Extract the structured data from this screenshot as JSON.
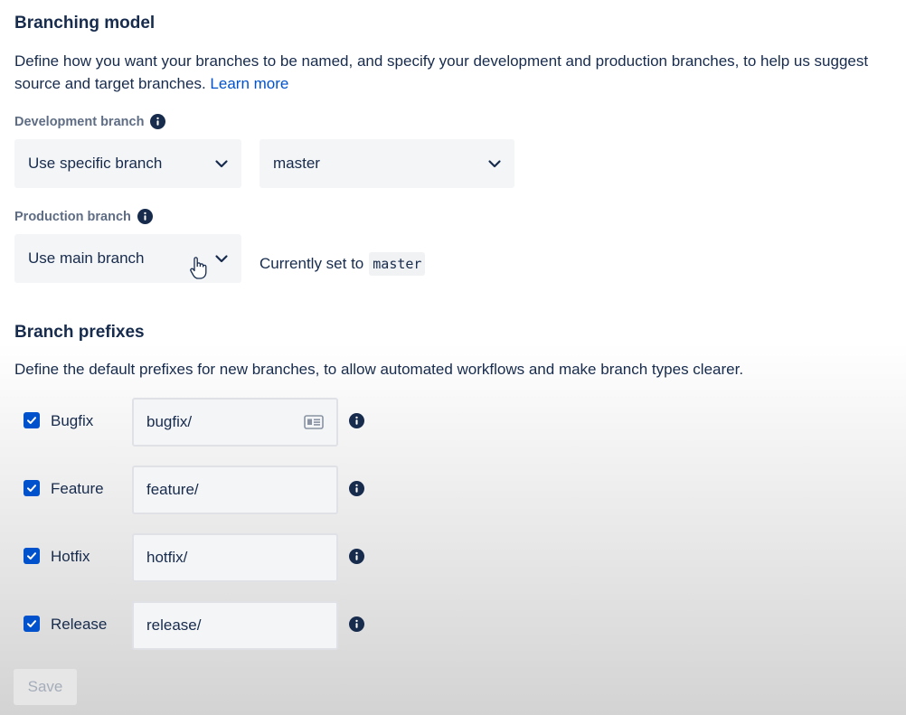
{
  "branching_model": {
    "heading": "Branching model",
    "description": "Define how you want your branches to be named, and specify your development and production branches, to help us suggest source and target branches.",
    "learn_more": "Learn more",
    "development_branch": {
      "label": "Development branch",
      "mode_value": "Use specific branch",
      "branch_value": "master"
    },
    "production_branch": {
      "label": "Production branch",
      "mode_value": "Use main branch",
      "currently_set_text": "Currently set to",
      "currently_set_value": "master"
    }
  },
  "branch_prefixes": {
    "heading": "Branch prefixes",
    "description": "Define the default prefixes for new branches, to allow automated workflows and make branch types clearer.",
    "rows": [
      {
        "label": "Bugfix",
        "value": "bugfix/",
        "checked": true
      },
      {
        "label": "Feature",
        "value": "feature/",
        "checked": true
      },
      {
        "label": "Hotfix",
        "value": "hotfix/",
        "checked": true
      },
      {
        "label": "Release",
        "value": "release/",
        "checked": true
      }
    ]
  },
  "save_label": "Save",
  "colors": {
    "primary_text": "#172b4d",
    "link": "#0052cc",
    "checkbox": "#0052cc",
    "muted_label": "#5e6c84",
    "field_bg": "#f4f5f7"
  },
  "icons": [
    "info-icon",
    "chevron-down-icon",
    "check-icon",
    "contact-card-icon",
    "hand-cursor-icon"
  ]
}
